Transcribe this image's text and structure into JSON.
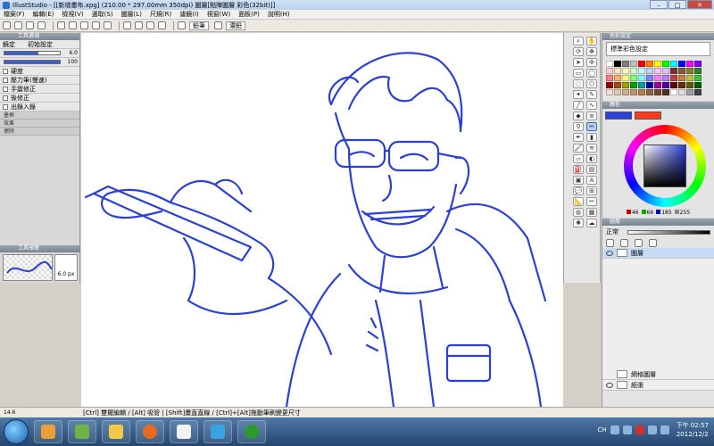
{
  "window": {
    "title": "IllustStudio - [[新增畫布.xpg] (210.00 * 297.00mm 350dpi)  圖層[點陣圖層 彩色(32bit)]]",
    "min": "–",
    "max": "□",
    "close": "✕"
  },
  "menu": [
    "檔案(F)",
    "編輯(E)",
    "檢視(V)",
    "選取(S)",
    "圖層(L)",
    "尺規(R)",
    "濾鏡(I)",
    "視窗(W)",
    "面板(P)",
    "說明(H)"
  ],
  "toolbar": {
    "tool_label": "鉛筆",
    "sub_label": "濃鉛"
  },
  "tool_options": {
    "header": "工具選項",
    "preset_label": "鏡定",
    "preset_value": "初始設定",
    "size_value": "6.0",
    "opacity_value": "100",
    "density_label": "硬度",
    "pressure_label": "壓力筆(慢速)",
    "stabilizer_label": "手震修正",
    "post_correction_label": "後修正",
    "in_out_label": "出錄入錄",
    "sections": [
      "墨框",
      "效果",
      "擦除"
    ],
    "brush_panel_header": "工具預覽",
    "brush_size_text": "6.0 px"
  },
  "palette_panel": {
    "header": "色彩設定",
    "dropdown": "標準彩色設定",
    "colors": [
      "#ffffff",
      "#000000",
      "#7f7f7f",
      "#c0c0c0",
      "#ff0000",
      "#ff7f00",
      "#ffff00",
      "#00ff00",
      "#00ffff",
      "#0000ff",
      "#ff00ff",
      "#7f00ff",
      "#ffd0d0",
      "#ffe0c0",
      "#ffffc0",
      "#d0ffd0",
      "#c0ffff",
      "#c0d0ff",
      "#ffc0ff",
      "#e0c0ff",
      "#803030",
      "#806030",
      "#808030",
      "#308030",
      "#ff8080",
      "#ffb070",
      "#ffff80",
      "#80ff80",
      "#80ffff",
      "#8080ff",
      "#ff80ff",
      "#b080ff",
      "#c04040",
      "#c08040",
      "#c0c040",
      "#40c040",
      "#a00000",
      "#a05000",
      "#a0a000",
      "#00a000",
      "#00a0a0",
      "#0000a0",
      "#a000a0",
      "#5000a0",
      "#600000",
      "#603000",
      "#606000",
      "#006000",
      "#f0e0d0",
      "#e0c8b0",
      "#d0b090",
      "#c09870",
      "#b08050",
      "#906040",
      "#704830",
      "#503020",
      "#ffffff",
      "#e0e0e0",
      "#a0a0a0",
      "#404040"
    ]
  },
  "color_panel": {
    "header": "顏色",
    "main_color": "#2c3fd8",
    "sub_color": "#ff3b1f",
    "r": "46",
    "g": "66",
    "b": "185",
    "a": "255"
  },
  "layer_panel": {
    "header": "圖層",
    "blend_mode": "正常",
    "layers": [
      {
        "name": "圖層",
        "selected": true
      },
      {
        "name": "網格圖層",
        "selected": false
      },
      {
        "name": "紙張",
        "selected": false
      }
    ]
  },
  "status": {
    "zoom": "14.6",
    "hint": "[Ctrl] 雙擺編輯 / [Alt] 吸管 | [Shift]畫直直線 / [Ctrl]+[Alt]拖動筆刷變更尺寸"
  },
  "taskbar": {
    "tray_lang": "CH",
    "time": "下午 02:57",
    "date": "2012/12/2"
  }
}
